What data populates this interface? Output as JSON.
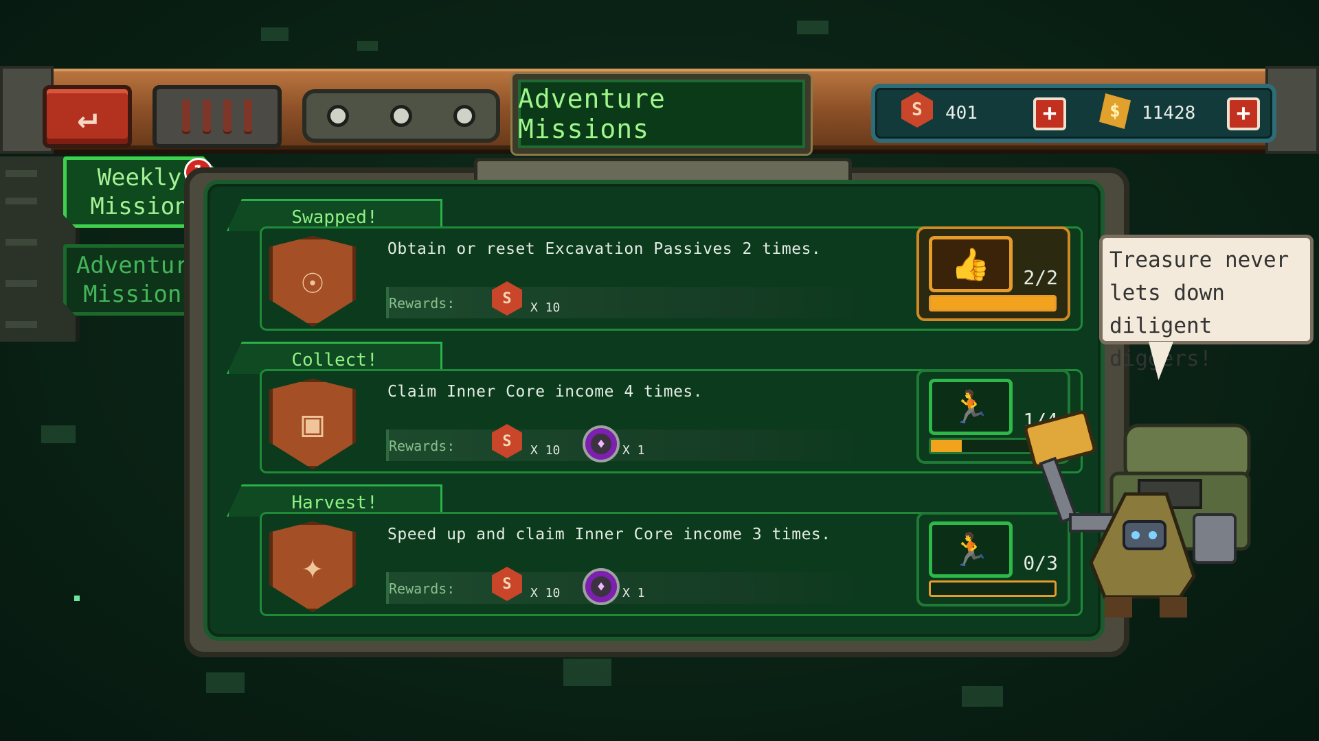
{
  "header": {
    "title": "Adventure Missions",
    "back_icon": "back-arrow-icon"
  },
  "currencies": [
    {
      "icon": "red-crystal-icon",
      "value": "401"
    },
    {
      "icon": "gold-ore-icon",
      "value": "11428"
    }
  ],
  "tabs": [
    {
      "label": "Weekly Mission",
      "active": true,
      "badge": "1"
    },
    {
      "label": "Adventure Missions",
      "active": false
    }
  ],
  "missions": [
    {
      "title": "Swapped!",
      "description": "Obtain or reset Excavation Passives 2 times.",
      "rewards_label": "Rewards:",
      "rewards": [
        {
          "icon": "red-crystal-icon",
          "qty": "X 10"
        }
      ],
      "progress": "2/2",
      "progress_fraction": 1.0,
      "state": "completed",
      "status_icon": "thumbs-up-icon"
    },
    {
      "title": "Collect!",
      "description": "Claim Inner Core income 4 times.",
      "rewards_label": "Rewards:",
      "rewards": [
        {
          "icon": "red-crystal-icon",
          "qty": "X 10"
        },
        {
          "icon": "purple-gem-icon",
          "qty": "X 1"
        }
      ],
      "progress": "1/4",
      "progress_fraction": 0.25,
      "state": "in-progress",
      "status_icon": "running-man-icon"
    },
    {
      "title": "Harvest!",
      "description": "Speed up and claim Inner Core income 3 times.",
      "rewards_label": "Rewards:",
      "rewards": [
        {
          "icon": "red-crystal-icon",
          "qty": "X 10"
        },
        {
          "icon": "purple-gem-icon",
          "qty": "X 1"
        }
      ],
      "progress": "0/3",
      "progress_fraction": 0.0,
      "state": "in-progress",
      "status_icon": "running-man-icon"
    }
  ],
  "speech": {
    "text_line1": "Treasure never",
    "text_line2": "lets down",
    "text_line3": "diligent diggers!"
  },
  "colors": {
    "accent_green": "#2eb84a",
    "progress_orange": "#f2a21c",
    "frame_copper": "#8e5128"
  }
}
